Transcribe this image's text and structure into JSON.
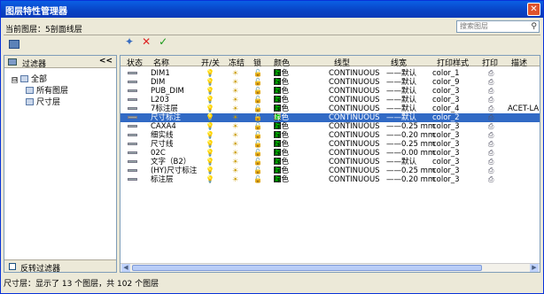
{
  "window": {
    "title": "图层特性管理器",
    "close": "✕"
  },
  "current_layer": "当前图层：5剖面线层",
  "search": {
    "placeholder": "搜索图层",
    "icon": "magnifier-icon"
  },
  "toolbar": {
    "new_layer": "✦",
    "delete_layer": "✕",
    "set_current": "✓"
  },
  "filter_panel": {
    "header": "过滤器",
    "collapse": "<<",
    "tree": [
      {
        "label": "全部",
        "toggle": "⊟"
      },
      {
        "label": "所有图层"
      },
      {
        "label": "尺寸层"
      }
    ],
    "invert_label": "反转过滤器"
  },
  "columns": [
    "状态",
    "名称",
    "开/关",
    "冻结",
    "锁",
    "颜色",
    "线型",
    "线宽",
    "打印样式",
    "打印",
    "描述"
  ],
  "rows": [
    {
      "name": "DIM1",
      "color": "绿色",
      "linetype": "CONTINUOUS",
      "lineweight": "——默认",
      "style": "color_1",
      "desc": ""
    },
    {
      "name": "DIM",
      "color": "绿色",
      "linetype": "CONTINUOUS",
      "lineweight": "——默认",
      "style": "color_9",
      "desc": ""
    },
    {
      "name": "PUB_DIM",
      "color": "绿色",
      "linetype": "CONTINUOUS",
      "lineweight": "——默认",
      "style": "color_3",
      "desc": ""
    },
    {
      "name": "L203",
      "color": "绿色",
      "linetype": "CONTINUOUS",
      "lineweight": "——默认",
      "style": "color_3",
      "desc": ""
    },
    {
      "name": "7标注层",
      "color": "绿色",
      "linetype": "CONTINUOUS",
      "lineweight": "——默认",
      "style": "color_4",
      "desc": "ACET-LA"
    },
    {
      "name": "尺寸标注",
      "color": "绿色",
      "linetype": "CONTINUOUS",
      "lineweight": "——默认",
      "style": "color_2",
      "desc": "",
      "selected": true
    },
    {
      "name": "CAXA4",
      "color": "绿色",
      "linetype": "CONTINUOUS",
      "lineweight": "——0.25 mm",
      "style": "color_3",
      "desc": ""
    },
    {
      "name": "细实线",
      "color": "绿色",
      "linetype": "CONTINUOUS",
      "lineweight": "——0.20 mm",
      "style": "color_3",
      "desc": ""
    },
    {
      "name": "尺寸线",
      "color": "绿色",
      "linetype": "CONTINUOUS",
      "lineweight": "——0.25 mm",
      "style": "color_3",
      "desc": ""
    },
    {
      "name": "02C",
      "color": "绿色",
      "linetype": "CONTINUOUS",
      "lineweight": "——0.00 mm",
      "style": "color_3",
      "desc": ""
    },
    {
      "name": "文字（B2）",
      "color": "绿色",
      "linetype": "CONTINUOUS",
      "lineweight": "——默认",
      "style": "color_3",
      "desc": ""
    },
    {
      "name": "(HY)尺寸标注",
      "color": "绿色",
      "linetype": "CONTINUOUS",
      "lineweight": "——0.25 mm",
      "style": "color_3",
      "desc": ""
    },
    {
      "name": "标注层",
      "color": "绿色",
      "linetype": "CONTINUOUS",
      "lineweight": "——0.20 mm",
      "style": "color_3",
      "desc": ""
    }
  ],
  "icons": {
    "on": "💡",
    "freeze": "☀",
    "lock": "🔓",
    "print": "⎙"
  },
  "status": "尺寸层：显示了 13 个图层，共 102 个图层"
}
